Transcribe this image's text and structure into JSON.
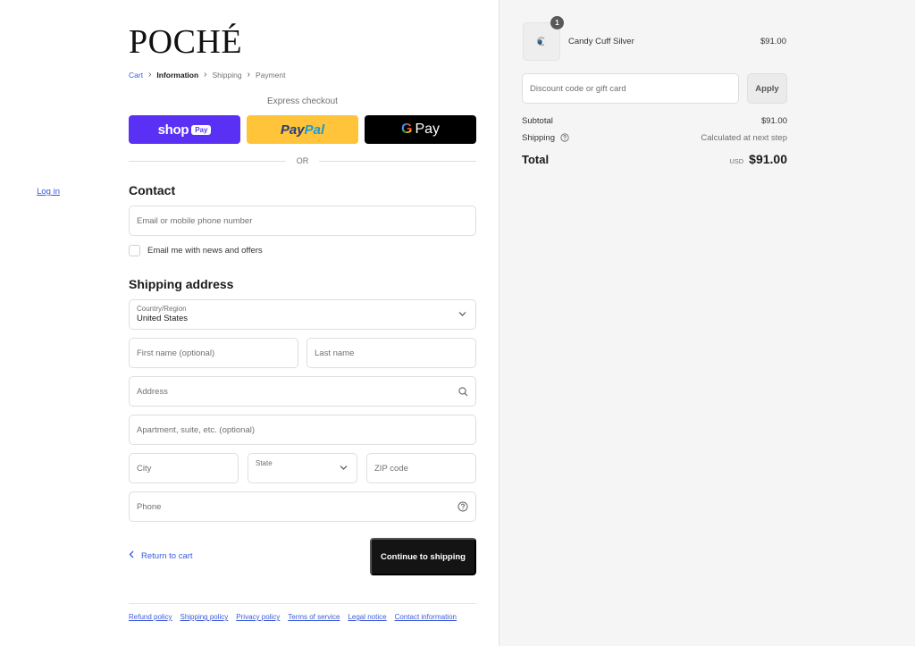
{
  "brand": {
    "logo": "POCHÉ"
  },
  "breadcrumb": {
    "items": [
      {
        "label": "Cart",
        "state": "link"
      },
      {
        "label": "Information",
        "state": "current"
      },
      {
        "label": "Shipping",
        "state": "upcoming"
      },
      {
        "label": "Payment",
        "state": "upcoming"
      }
    ],
    "separator": "›"
  },
  "express": {
    "label": "Express checkout",
    "shop_pay": {
      "text": "shop",
      "badge": "Pay"
    },
    "paypal": {
      "part1": "Pay",
      "part2": "Pal"
    },
    "gpay": {
      "g": "G",
      "text": "Pay"
    },
    "or_label": "OR"
  },
  "contact": {
    "title": "Contact",
    "login_link": "Log in",
    "email_placeholder": "Email or mobile phone number",
    "newsletter_label": "Email me with news and offers",
    "newsletter_checked": false
  },
  "shipping": {
    "title": "Shipping address",
    "country_label": "Country/Region",
    "country_value": "United States",
    "first_name_placeholder": "First name (optional)",
    "last_name_placeholder": "Last name",
    "address_placeholder": "Address",
    "apartment_placeholder": "Apartment, suite, etc. (optional)",
    "city_placeholder": "City",
    "state_label": "State",
    "zip_placeholder": "ZIP code",
    "phone_placeholder": "Phone"
  },
  "actions": {
    "return_label": "Return to cart",
    "continue_label": "Continue to shipping"
  },
  "footer": {
    "links": [
      "Refund policy",
      "Shipping policy",
      "Privacy policy",
      "Terms of service",
      "Legal notice",
      "Contact information"
    ]
  },
  "order": {
    "product": {
      "name": "Candy Cuff Silver",
      "price": "$91.00",
      "quantity": "1"
    },
    "discount_placeholder": "Discount code or gift card",
    "apply_label": "Apply",
    "subtotal_label": "Subtotal",
    "subtotal_value": "$91.00",
    "shipping_label": "Shipping",
    "shipping_value": "Calculated at next step",
    "total_label": "Total",
    "currency": "USD",
    "total_value": "$91.00"
  },
  "colors": {
    "accent_link": "#3b5bdb",
    "shop_pay": "#5a31f4",
    "paypal": "#ffc439",
    "primary_button": "#141414"
  }
}
